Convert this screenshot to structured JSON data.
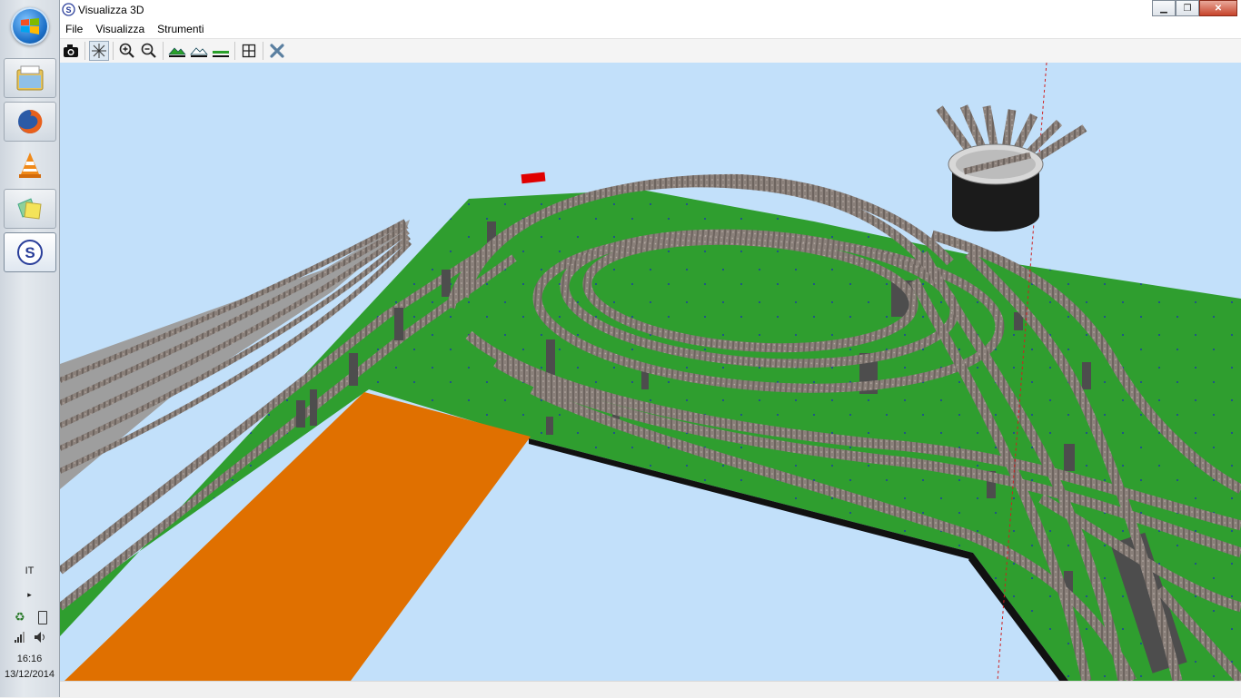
{
  "window": {
    "title": "Visualizza 3D"
  },
  "menu": [
    {
      "label": "File"
    },
    {
      "label": "Visualizza"
    },
    {
      "label": "Strumenti"
    }
  ],
  "toolbar": {
    "tools": [
      "camera-icon",
      "crosshair-icon",
      "zoom-in-icon",
      "zoom-out-icon",
      "terrain-up-icon",
      "terrain-down-icon",
      "flat-icon",
      "fit-view-icon",
      "close-view-icon"
    ]
  },
  "taskbar": {
    "apps": [
      "start-button",
      "file-manager",
      "firefox",
      "vlc",
      "sticky-notes",
      "simulator-app"
    ],
    "language": "IT",
    "time": "16:16",
    "date": "13/12/2014"
  },
  "colors": {
    "sky": "#c2e0fa",
    "board": "#2f9e2f",
    "orange_area": "#e07000",
    "track": "#7a6f6a",
    "pillar": "#5a5a5a"
  }
}
